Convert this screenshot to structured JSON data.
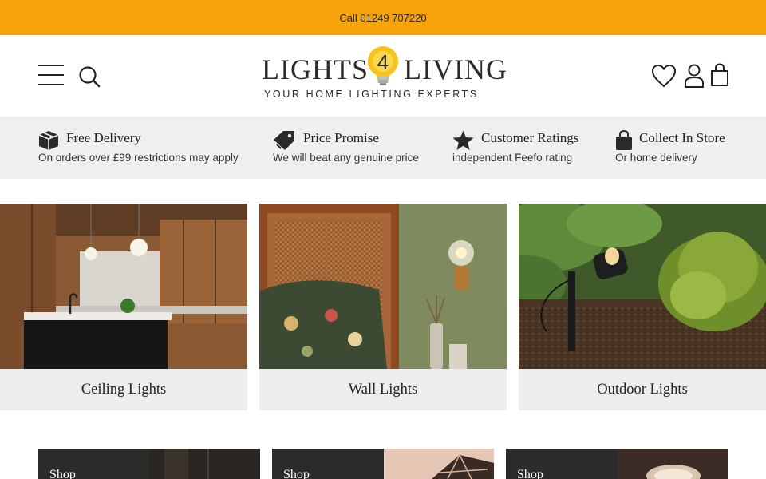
{
  "topbar": {
    "phone_text": "Call 01249 707220"
  },
  "header": {
    "logo": {
      "word_left": "LIGHTS",
      "word_right": "LIVING",
      "bulb_number": "4",
      "tagline": "YOUR HOME LIGHTING EXPERTS"
    },
    "icons": [
      "menu-icon",
      "search-icon",
      "heart-icon",
      "user-icon",
      "bag-icon"
    ]
  },
  "usps": [
    {
      "icon": "box-icon",
      "title": "Free Delivery",
      "subtitle": "On orders over £99 restrictions may apply"
    },
    {
      "icon": "tag-icon",
      "title": "Price Promise",
      "subtitle": "We will beat any genuine price"
    },
    {
      "icon": "star-icon",
      "title": "Customer Ratings",
      "subtitle": "independent Feefo rating"
    },
    {
      "icon": "shopping-bag-icon",
      "title": "Collect In Store",
      "subtitle": "Or home delivery"
    }
  ],
  "categories": [
    {
      "label": "Ceiling Lights"
    },
    {
      "label": "Wall Lights"
    },
    {
      "label": "Outdoor Lights"
    }
  ],
  "shop_tiles": [
    {
      "label": "Shop"
    },
    {
      "label": "Shop"
    },
    {
      "label": "Shop"
    }
  ],
  "colors": {
    "topbar": "#f7a30c",
    "usp_bar": "#f0efed",
    "category_label_bg": "#efeeec",
    "dark_tile": "#2c2b2a"
  }
}
